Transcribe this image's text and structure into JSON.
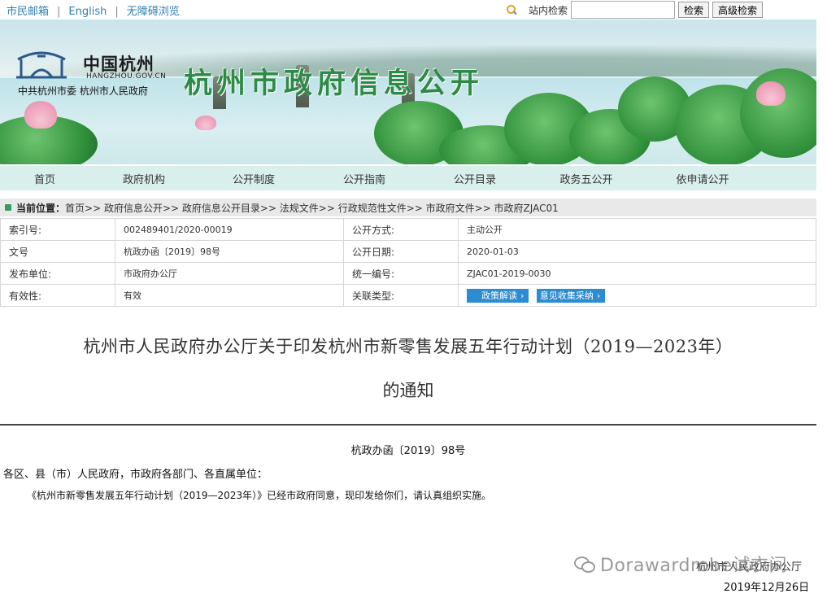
{
  "top": {
    "links": [
      "市民邮箱",
      "English",
      "无障碍浏览"
    ],
    "search_label": "站内检索",
    "search_value": "",
    "search_button": "检索",
    "advanced_button": "高级检索"
  },
  "banner": {
    "logo_cn": "中国杭州",
    "logo_en": "HANGZHOU.GOV.CN",
    "logo_sub": "中共杭州市委  杭州市人民政府",
    "title": "杭州市政府信息公开"
  },
  "nav": [
    "首页",
    "政府机构",
    "公开制度",
    "公开指南",
    "公开目录",
    "政务五公开",
    "依申请公开"
  ],
  "breadcrumb": {
    "label": "当前位置：",
    "path": "首页>> 政府信息公开>> 政府信息公开目录>> 法规文件>> 行政规范性文件>> 市政府文件>> 市政府ZJAC01"
  },
  "info": {
    "index_key": "索引号:",
    "index_val": "002489401/2020-00019",
    "method_key": "公开方式:",
    "method_val": "主动公开",
    "docno_key": "文号",
    "docno_val": "杭政办函〔2019〕98号",
    "date_key": "公开日期:",
    "date_val": "2020-01-03",
    "org_key": "发布单位:",
    "org_val": "市政府办公厅",
    "unified_key": "统一编号:",
    "unified_val": "ZJAC01-2019-0030",
    "valid_key": "有效性:",
    "valid_val": "有效",
    "related_key": "关联类型:",
    "chip1": "政策解读",
    "chip2": "意见收集采纳"
  },
  "article": {
    "title_line1": "杭州市人民政府办公厅关于印发杭州市新零售发展五年行动计划（2019—2023年）",
    "title_line2": "的通知",
    "doc_no": "杭政办函〔2019〕98号",
    "addressee": "各区、县（市）人民政府，市政府各部门、各直属单位：",
    "body": "《杭州市新零售发展五年行动计划（2019—2023年）》已经市政府同意，现印发给你们，请认真组织实施。",
    "signature_org": "杭州市人民政府办公厅",
    "signature_date": "2019年12月26日"
  },
  "watermark": "Dorawardrobe试衣间",
  "colors": {
    "nav_bg": "#d9efeb",
    "chip_bg": "#2d8bd0",
    "title_green": "#2d8a48",
    "link_blue": "#2f7fb5"
  }
}
